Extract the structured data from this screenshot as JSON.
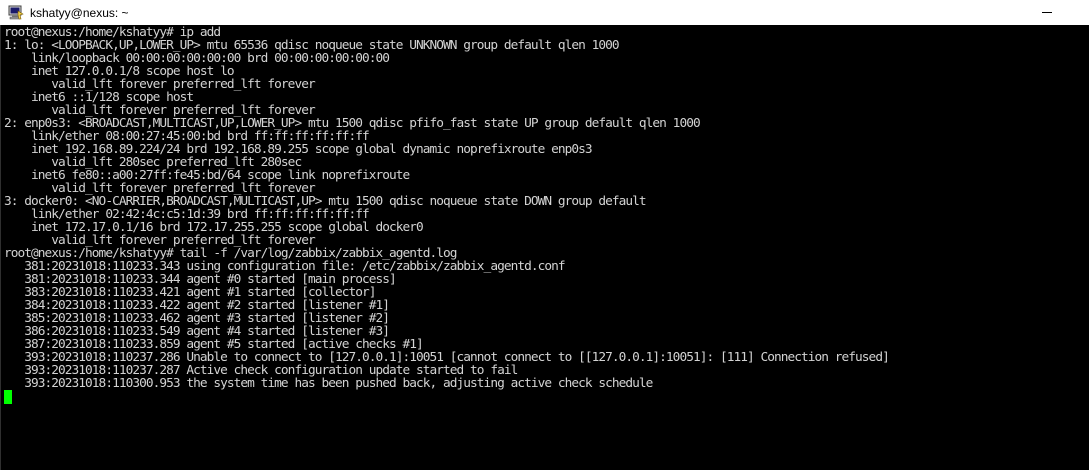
{
  "window": {
    "title": "kshatyy@nexus: ~",
    "icon": "putty-terminal-icon"
  },
  "colors": {
    "terminal_bg": "#000000",
    "terminal_fg": "#d3d3d3",
    "cursor": "#00ff00",
    "titlebar_bg": "#ffffff"
  },
  "terminal": {
    "lines": [
      "root@nexus:/home/kshatyy# ip add",
      "1: lo: <LOOPBACK,UP,LOWER_UP> mtu 65536 qdisc noqueue state UNKNOWN group default qlen 1000",
      "    link/loopback 00:00:00:00:00:00 brd 00:00:00:00:00:00",
      "    inet 127.0.0.1/8 scope host lo",
      "       valid_lft forever preferred_lft forever",
      "    inet6 ::1/128 scope host",
      "       valid_lft forever preferred_lft forever",
      "2: enp0s3: <BROADCAST,MULTICAST,UP,LOWER_UP> mtu 1500 qdisc pfifo_fast state UP group default qlen 1000",
      "    link/ether 08:00:27:45:00:bd brd ff:ff:ff:ff:ff:ff",
      "    inet 192.168.89.224/24 brd 192.168.89.255 scope global dynamic noprefixroute enp0s3",
      "       valid_lft 280sec preferred_lft 280sec",
      "    inet6 fe80::a00:27ff:fe45:bd/64 scope link noprefixroute",
      "       valid_lft forever preferred_lft forever",
      "3: docker0: <NO-CARRIER,BROADCAST,MULTICAST,UP> mtu 1500 qdisc noqueue state DOWN group default",
      "    link/ether 02:42:4c:c5:1d:39 brd ff:ff:ff:ff:ff:ff",
      "    inet 172.17.0.1/16 brd 172.17.255.255 scope global docker0",
      "       valid_lft forever preferred_lft forever",
      "root@nexus:/home/kshatyy# tail -f /var/log/zabbix/zabbix_agentd.log",
      "   381:20231018:110233.343 using configuration file: /etc/zabbix/zabbix_agentd.conf",
      "   381:20231018:110233.344 agent #0 started [main process]",
      "   383:20231018:110233.421 agent #1 started [collector]",
      "   384:20231018:110233.422 agent #2 started [listener #1]",
      "   385:20231018:110233.462 agent #3 started [listener #2]",
      "   386:20231018:110233.549 agent #4 started [listener #3]",
      "   387:20231018:110233.859 agent #5 started [active checks #1]",
      "   393:20231018:110237.286 Unable to connect to [127.0.0.1]:10051 [cannot connect to [[127.0.0.1]:10051]: [111] Connection refused]",
      "   393:20231018:110237.287 Active check configuration update started to fail",
      "   393:20231018:110300.953 the system time has been pushed back, adjusting active check schedule"
    ]
  }
}
